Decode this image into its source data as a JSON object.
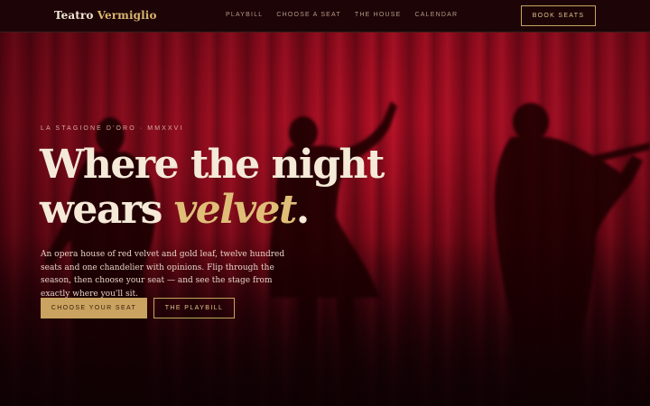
{
  "brand": {
    "name_part1": "Teatro",
    "name_part2": "Vermiglio"
  },
  "nav": {
    "links": [
      "PLAYBILL",
      "CHOOSE A SEAT",
      "THE HOUSE",
      "CALENDAR"
    ],
    "cta": "BOOK SEATS"
  },
  "hero": {
    "eyebrow": "LA STAGIONE D'ORO · MMXXVI",
    "headline_line1": "Where the night",
    "headline_line2_plain": "wears",
    "headline_line2_accent": "velvet",
    "headline_period": ".",
    "lede": "An opera house of red velvet and gold leaf, twelve hundred seats and one chandelier with opinions. Flip through the season, then choose your seat — and see the stage from exactly where you'll sit.",
    "primary_cta": "CHOOSE YOUR SEAT",
    "secondary_cta": "THE PLAYBILL"
  },
  "colors": {
    "curtain_red": "#a80d22",
    "gold_accent": "#c9a35f",
    "cream_text": "#f5e9d8",
    "nav_background": "#1c0407"
  },
  "hero_image": "silhouettes of three performers against a red velvet curtain"
}
